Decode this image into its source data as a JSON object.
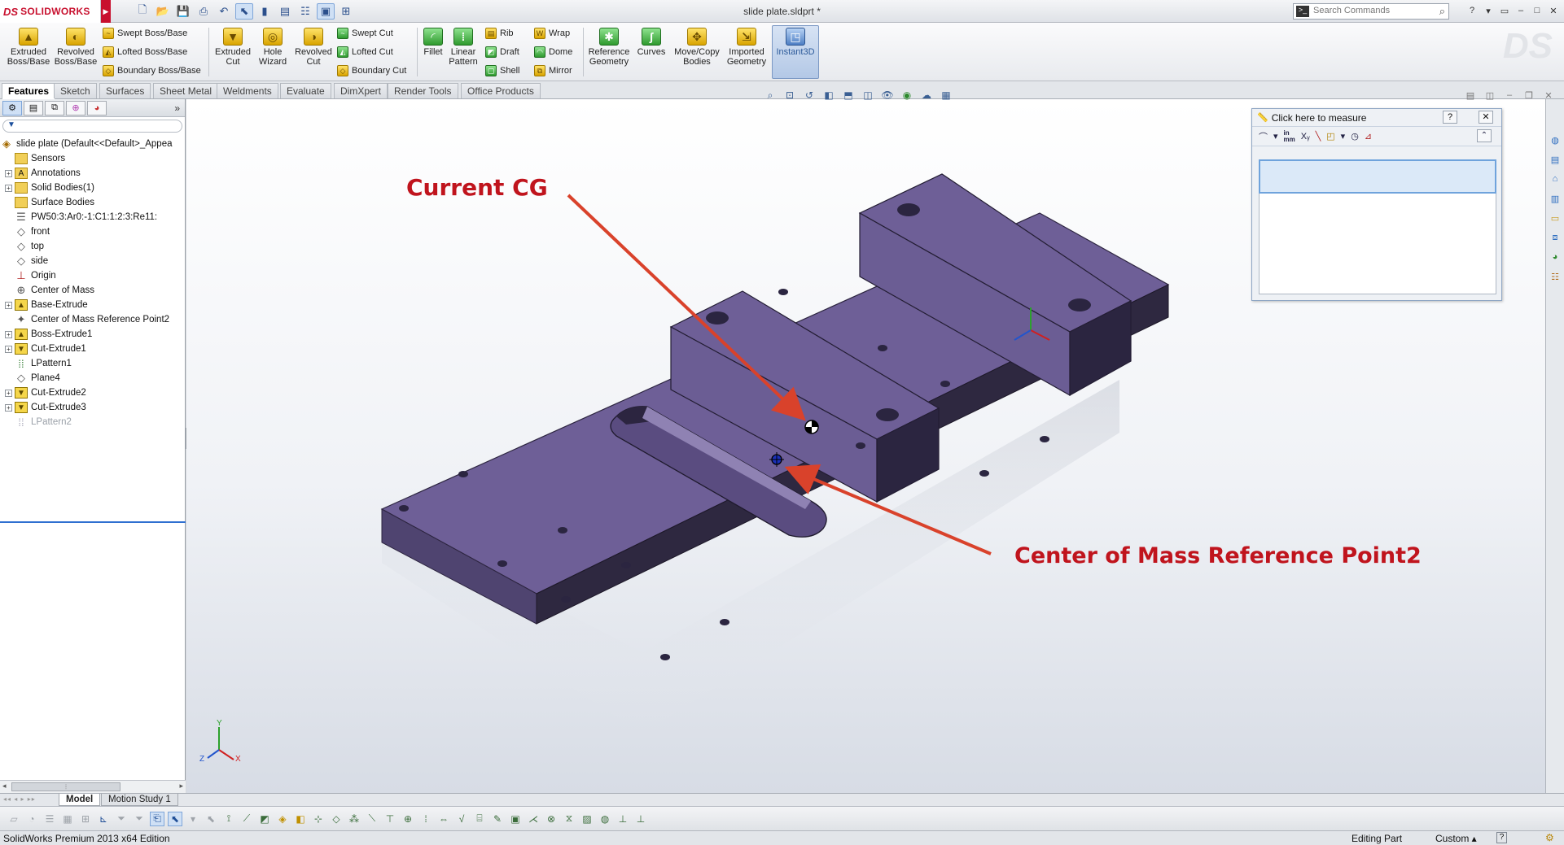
{
  "app": {
    "brand": "SOLIDWORKS",
    "brand_mark": "DS",
    "document_title": "slide plate.sldprt *"
  },
  "search": {
    "placeholder": "Search Commands"
  },
  "command_manager": {
    "extruded_boss": "Extruded Boss/Base",
    "revolved_boss": "Revolved Boss/Base",
    "swept_boss": "Swept Boss/Base",
    "lofted_boss": "Lofted Boss/Base",
    "boundary_boss": "Boundary Boss/Base",
    "extruded_cut": "Extruded Cut",
    "hole_wizard": "Hole Wizard",
    "revolved_cut": "Revolved Cut",
    "swept_cut": "Swept Cut",
    "lofted_cut": "Lofted Cut",
    "boundary_cut": "Boundary Cut",
    "fillet": "Fillet",
    "linear_pattern": "Linear Pattern",
    "rib": "Rib",
    "draft": "Draft",
    "shell": "Shell",
    "wrap": "Wrap",
    "dome": "Dome",
    "mirror": "Mirror",
    "reference_geometry": "Reference Geometry",
    "curves": "Curves",
    "move_copy": "Move/Copy Bodies",
    "imported_geometry": "Imported Geometry",
    "instant3d": "Instant3D"
  },
  "tabs": [
    "Features",
    "Sketch",
    "Surfaces",
    "Sheet Metal",
    "Weldments",
    "Evaluate",
    "DimXpert",
    "Render Tools",
    "Office Products"
  ],
  "feature_tree": {
    "root": "slide plate  (Default<<Default>_Appea",
    "items": [
      {
        "label": "Sensors",
        "exp": false
      },
      {
        "label": "Annotations",
        "exp": true
      },
      {
        "label": "Solid Bodies(1)",
        "exp": true
      },
      {
        "label": "Surface Bodies",
        "exp": false
      },
      {
        "label": "PW50:3:Ar0:-1:C1:1:2:3:Re11:",
        "exp": false
      },
      {
        "label": "front",
        "exp": false
      },
      {
        "label": "top",
        "exp": false
      },
      {
        "label": "side",
        "exp": false
      },
      {
        "label": "Origin",
        "exp": false
      },
      {
        "label": "Center of Mass",
        "exp": false
      },
      {
        "label": "Base-Extrude",
        "exp": true
      },
      {
        "label": "Center of Mass Reference Point2",
        "exp": false
      },
      {
        "label": "Boss-Extrude1",
        "exp": true
      },
      {
        "label": "Cut-Extrude1",
        "exp": true
      },
      {
        "label": "LPattern1",
        "exp": false
      },
      {
        "label": "Plane4",
        "exp": false
      },
      {
        "label": "Cut-Extrude2",
        "exp": true
      },
      {
        "label": "Cut-Extrude3",
        "exp": true
      },
      {
        "label": "LPattern2",
        "exp": false
      }
    ]
  },
  "annotations": {
    "current_cg": "Current CG",
    "com_ref": "Center of Mass Reference Point2"
  },
  "measure": {
    "title": "Click here to measure",
    "units_label_top": "in",
    "units_label_bottom": "mm"
  },
  "axis_labels": {
    "y": "Y",
    "x": "X",
    "z": "Z"
  },
  "bottom_tabs": {
    "model": "Model",
    "motion": "Motion Study 1"
  },
  "status": {
    "edition": "SolidWorks Premium 2013 x64 Edition",
    "mode": "Editing Part",
    "units": "Custom",
    "help": "?"
  },
  "colors": {
    "part": "#6e5f97",
    "annotation": "#c0141d",
    "brand": "#c8102e"
  }
}
